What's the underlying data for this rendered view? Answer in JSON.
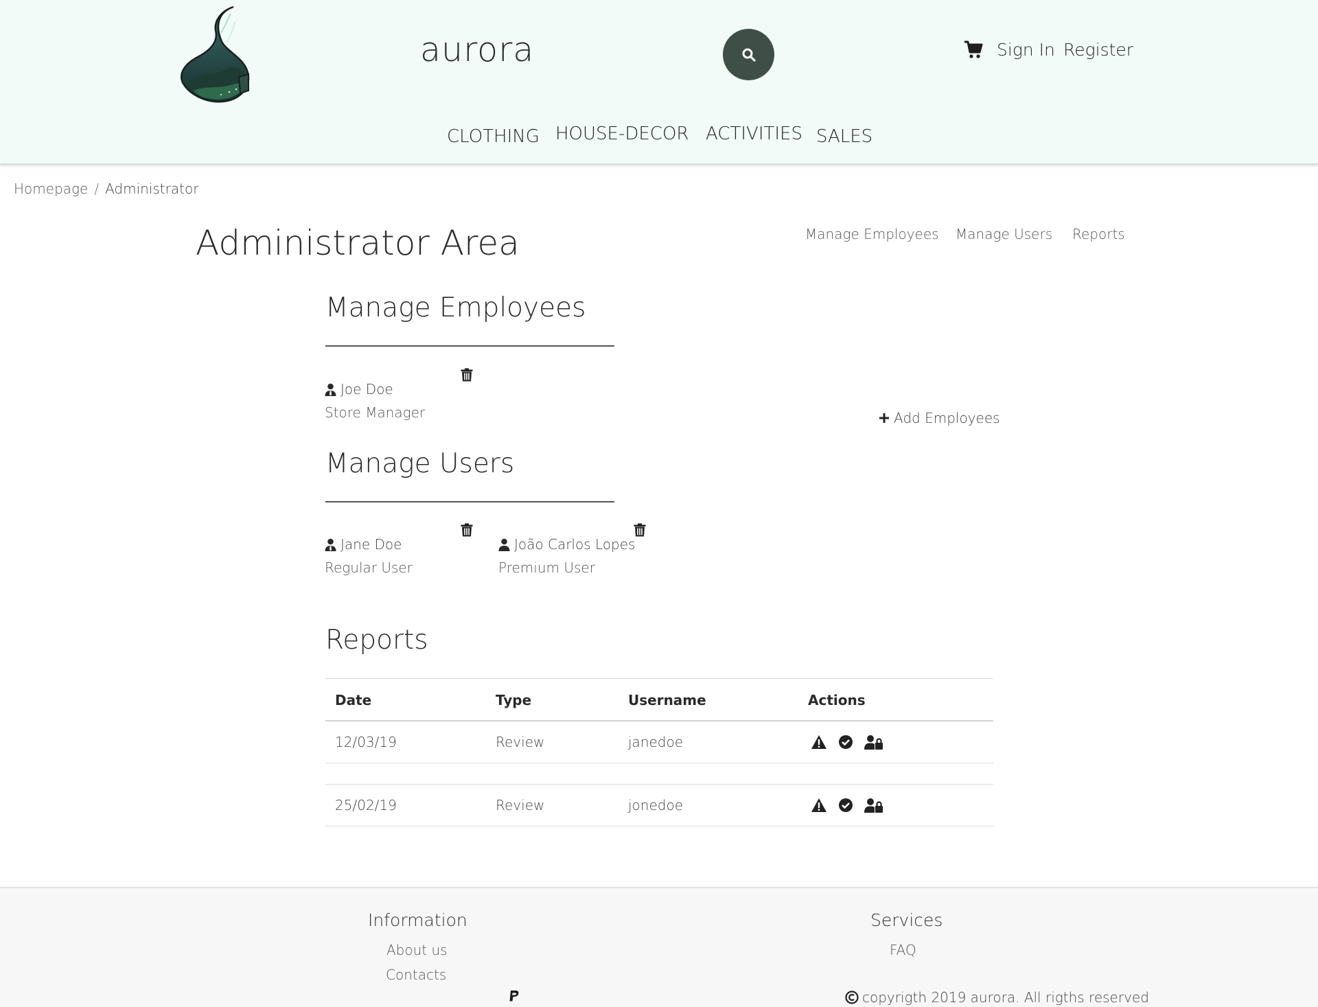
{
  "header": {
    "brand": "aurora",
    "sign_in": "Sign In",
    "register": "Register",
    "nav": [
      "CLOTHING",
      "HOUSE-DECOR",
      "ACTIVITIES",
      "SALES"
    ],
    "icons": [
      "search-icon",
      "cart-icon"
    ],
    "search_button_color": "#3f4f48",
    "background": "#f2fbf7"
  },
  "breadcrumb": [
    "Homepage",
    "Administrator"
  ],
  "admin": {
    "title": "Administrator Area",
    "side_links": [
      "Manage Employees",
      "Manage Users",
      "Reports"
    ]
  },
  "employees": {
    "title": "Manage Employees",
    "add_label": "Add Employees",
    "items": [
      {
        "name": "Joe Doe",
        "role": "Store Manager"
      }
    ]
  },
  "users": {
    "title": "Manage Users",
    "items": [
      {
        "name": "Jane Doe",
        "role": "Regular User"
      },
      {
        "name": "João Carlos Lopes",
        "role": "Premium User"
      }
    ]
  },
  "reports": {
    "title": "Reports",
    "columns": [
      "Date",
      "Type",
      "Username",
      "Actions"
    ],
    "rows": [
      {
        "date": "12/03/19",
        "type": "Review",
        "username": "janedoe"
      },
      {
        "date": "25/02/19",
        "type": "Review",
        "username": "jonedoe"
      }
    ],
    "action_icons": [
      "warning-icon",
      "check-circle-icon",
      "user-lock-icon"
    ]
  },
  "footer": {
    "information_title": "Information",
    "about": "About us",
    "contacts": "Contacts",
    "services_title": "Services",
    "faq": "FAQ",
    "copyright": "copyrigth 2019 aurora. All rigths reserved"
  }
}
